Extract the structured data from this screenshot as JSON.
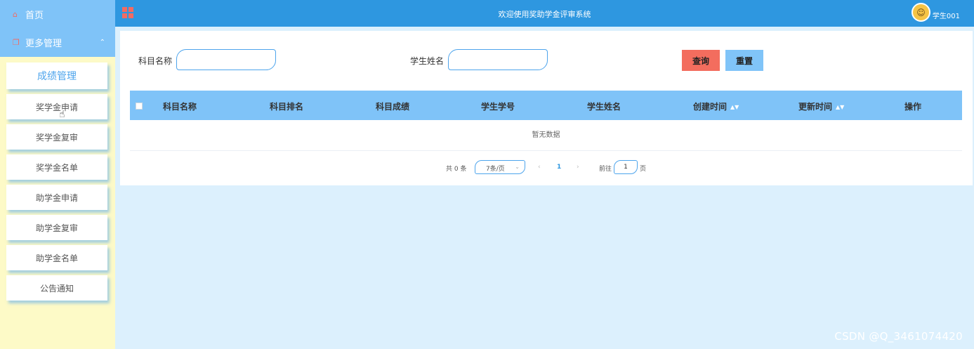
{
  "sidebar": {
    "home_label": "首页",
    "more_label": "更多管理",
    "items": [
      {
        "label": "成绩管理"
      },
      {
        "label": "奖学金申请"
      },
      {
        "label": "奖学金复审"
      },
      {
        "label": "奖学金名单"
      },
      {
        "label": "助学金申请"
      },
      {
        "label": "助学金复审"
      },
      {
        "label": "助学金名单"
      },
      {
        "label": "公告通知"
      }
    ]
  },
  "header": {
    "title": "欢迎使用奖助学金评审系统",
    "username": "学生001"
  },
  "search": {
    "subject_label": "科目名称",
    "subject_value": "",
    "student_label": "学生姓名",
    "student_value": "",
    "search_button": "查询",
    "reset_button": "重置"
  },
  "table": {
    "columns": [
      "科目名称",
      "科目排名",
      "科目成绩",
      "学生学号",
      "学生姓名",
      "创建时间",
      "更新时间",
      "操作"
    ],
    "empty_text": "暂无数据"
  },
  "pagination": {
    "total_text": "共 0 条",
    "page_size": "7条/页",
    "current_page": "1",
    "goto_label": "前往",
    "goto_value": "1",
    "page_suffix": "页"
  },
  "watermark": "CSDN @Q_3461074420",
  "colors": {
    "header": "#2e97e0",
    "sidebar_top": "#7fc3f8",
    "sidebar_bg": "#fdfac7",
    "search_button": "#f36d5e",
    "reset_button": "#80c4f8"
  }
}
